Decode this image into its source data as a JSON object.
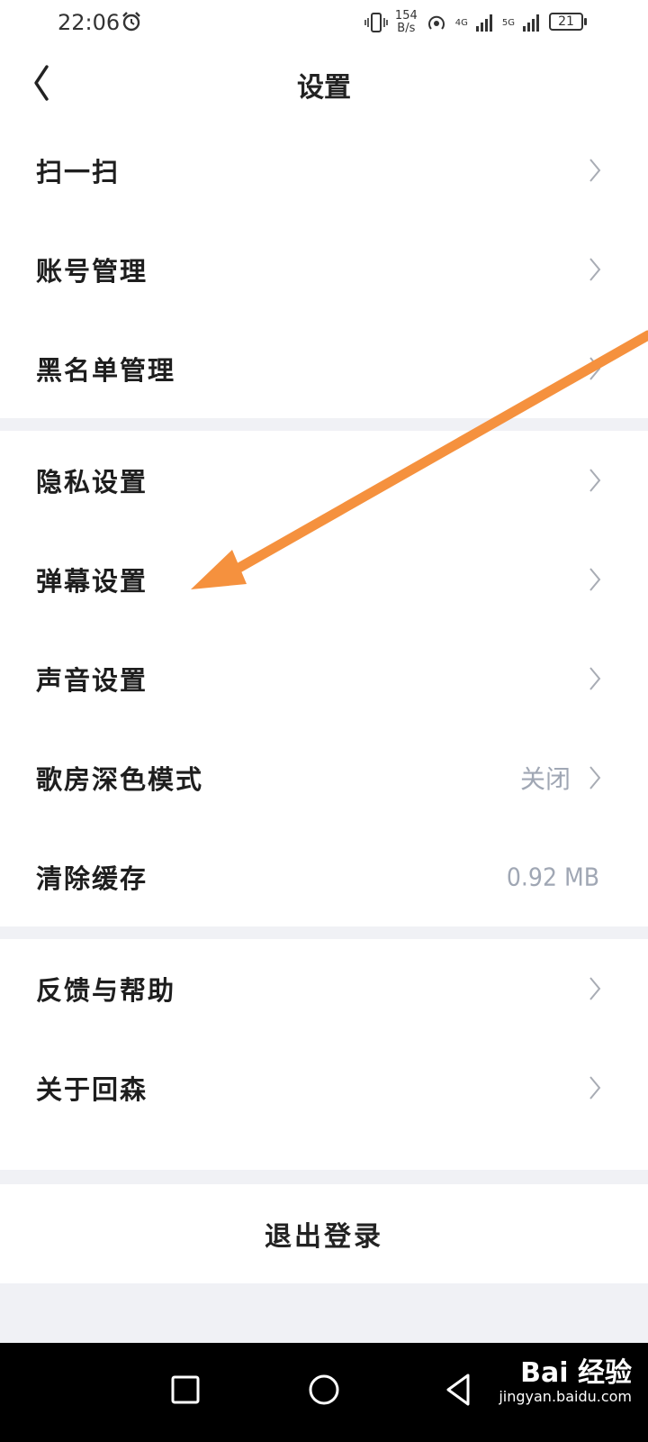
{
  "status_bar": {
    "time": "22:06",
    "net_speed_top": "154",
    "net_speed_bottom": "B/s",
    "net1": "4G",
    "net2": "5G",
    "battery": "21"
  },
  "header": {
    "title": "设置"
  },
  "groups": [
    {
      "items": [
        {
          "label": "扫一扫",
          "value": "",
          "arrow": true
        },
        {
          "label": "账号管理",
          "value": "",
          "arrow": true
        },
        {
          "label": "黑名单管理",
          "value": "",
          "arrow": true
        }
      ]
    },
    {
      "items": [
        {
          "label": "隐私设置",
          "value": "",
          "arrow": true
        },
        {
          "label": "弹幕设置",
          "value": "",
          "arrow": true
        },
        {
          "label": "声音设置",
          "value": "",
          "arrow": true
        },
        {
          "label": "歌房深色模式",
          "value": "关闭",
          "arrow": true
        },
        {
          "label": "清除缓存",
          "value": "0.92 MB",
          "arrow": false
        }
      ]
    },
    {
      "items": [
        {
          "label": "反馈与帮助",
          "value": "",
          "arrow": true
        },
        {
          "label": "关于回森",
          "value": "",
          "arrow": true
        }
      ]
    }
  ],
  "logout_label": "退出登录",
  "watermark": {
    "main": "Bai 经验",
    "sub": "jingyan.baidu.com"
  },
  "colors": {
    "annotation_arrow": "#f5913e",
    "secondary_text": "#a0a7b4",
    "divider_bg": "#f0f1f5"
  }
}
